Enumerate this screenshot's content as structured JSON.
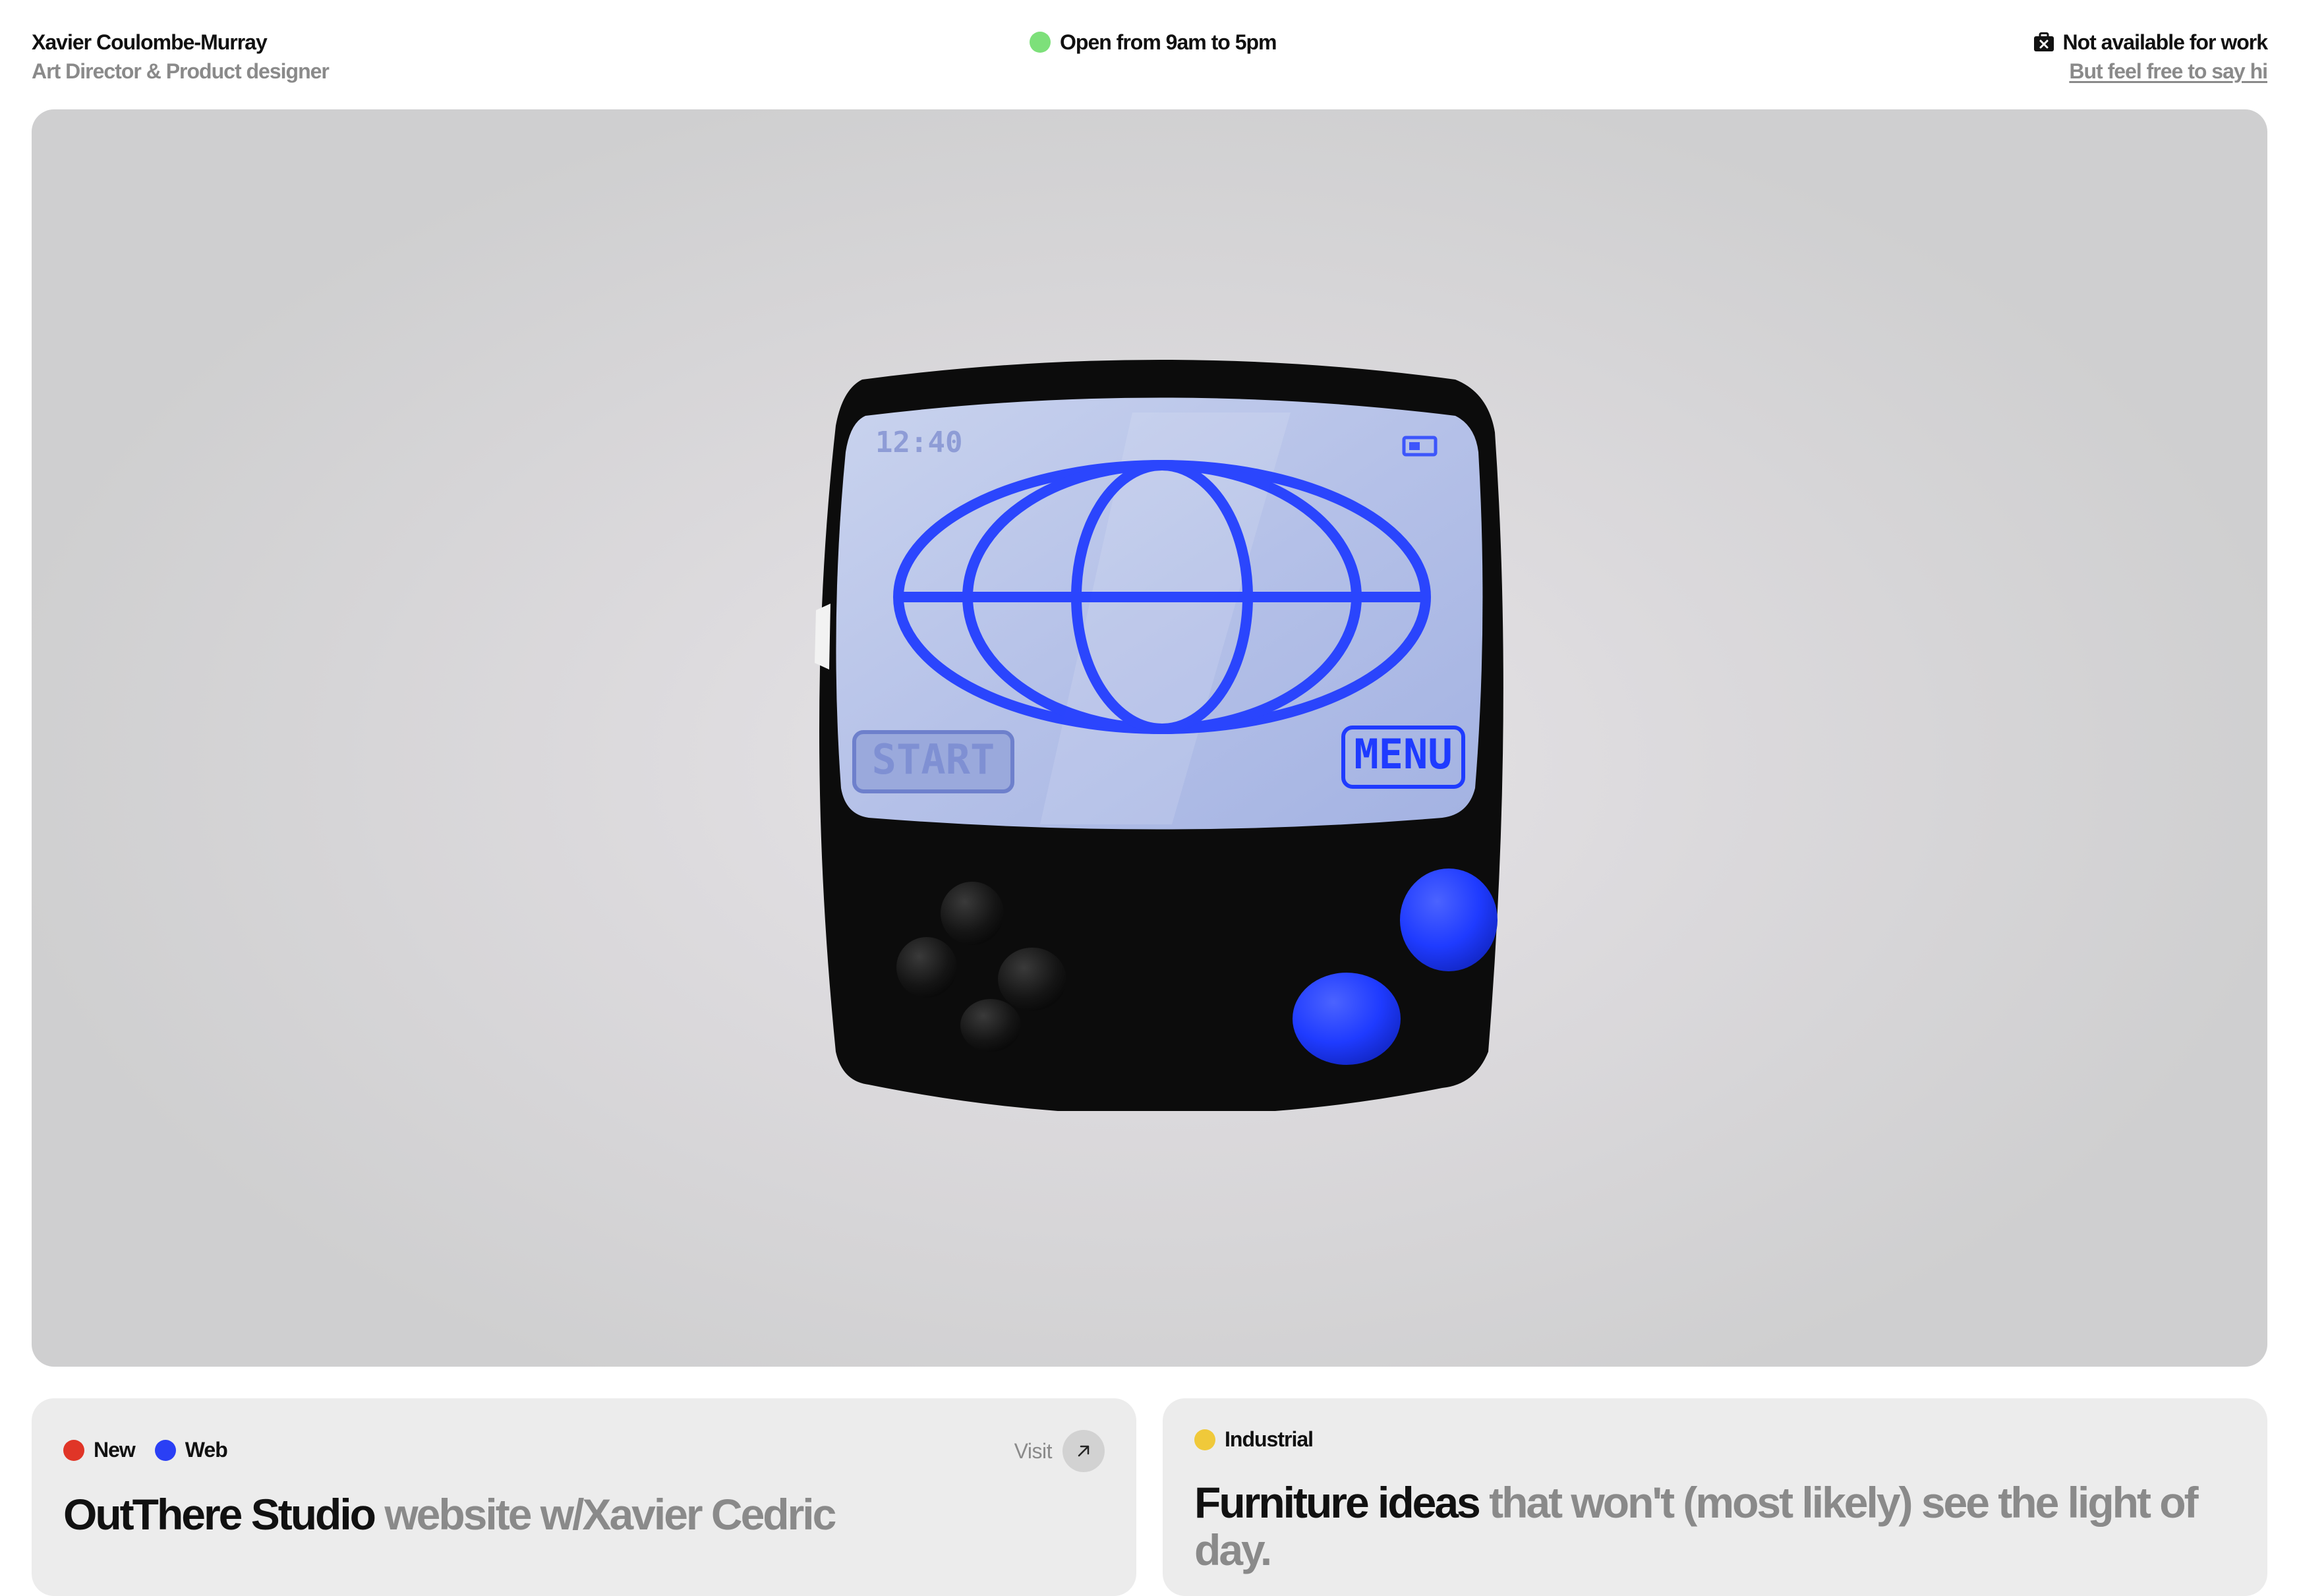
{
  "header": {
    "name": "Xavier Coulombe-Murray",
    "role": "Art Director & Product designer",
    "hours": "Open from 9am to 5pm",
    "hours_dot_color": "#7de07a",
    "availability": "Not available for work",
    "availability_icon": "briefcase-x-icon",
    "say_hi_link": "But feel free to say hi"
  },
  "hero": {
    "device": {
      "clock": "12:40",
      "start_label": "START",
      "menu_label": "MENU",
      "screen_icon": "globe-icon",
      "battery_icon": "battery-icon",
      "accent_color": "#1f3bff"
    }
  },
  "projects": [
    {
      "tags": [
        {
          "label": "New",
          "color": "#e03527"
        },
        {
          "label": "Web",
          "color": "#2a3ff5"
        }
      ],
      "visit_label": "Visit",
      "visit_icon": "arrow-up-right-icon",
      "title_strong": "OutThere Studio",
      "title_rest": "website w/Xavier Cedric"
    },
    {
      "tags": [
        {
          "label": "Industrial",
          "color": "#f0c93a"
        }
      ],
      "title_strong": "Furniture ideas",
      "title_rest": "that won't (most likely) see the light of day."
    }
  ]
}
